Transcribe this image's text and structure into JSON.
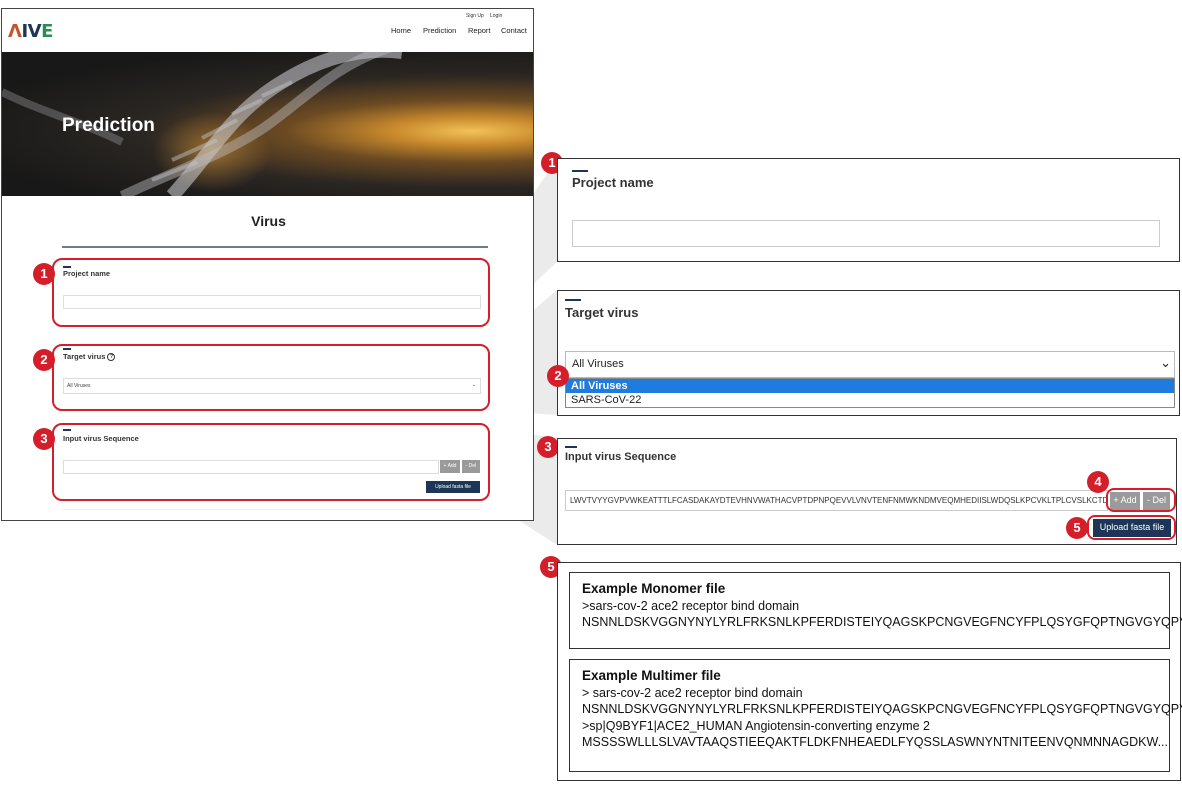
{
  "site": {
    "logo": {
      "a": "Λ",
      "b": "IV",
      "c": "E"
    },
    "top_links": {
      "signup": "Sign Up",
      "login": "Login"
    },
    "nav": [
      "Home",
      "Prediction",
      "Report",
      "Contact"
    ],
    "hero_title": "Prediction",
    "section_title": "Virus"
  },
  "form": {
    "project_name_label": "Project name",
    "target_virus_label": "Target virus",
    "info_icon_glyph": "?",
    "target_virus_value": "All Viruses",
    "target_virus_options": [
      "All Viruses",
      "SARS-CoV-22"
    ],
    "sequence_label": "Input virus Sequence",
    "sequence_value": "LWVTVYYGVPVWKEATTTLFCASDAKAYDTEVHNVWATHACVPTDPNPQEVVLVNVTENFNMWKNDMVEQMHEDIISLWDQSLKPCVKLTPLCVSLKCTDLKNDT",
    "add_button": "+ Add",
    "del_button": "- Del",
    "add_button_small": "+ Add",
    "del_button_small": "- Del",
    "upload_button": "Upload fasta file"
  },
  "badges": [
    "1",
    "2",
    "3",
    "4",
    "5"
  ],
  "examples": {
    "monomer": {
      "title": "Example Monomer file",
      "lines": [
        ">sars-cov-2 ace2 receptor bind domain",
        "NSNNLDSKVGGNYNYLYRLFRKSNLKPFERDISTEIYQAGSKPCNGVEGFNCYFPLQSYGFQPTNGVGYQPY"
      ]
    },
    "multimer": {
      "title": "Example Multimer file",
      "lines": [
        "> sars-cov-2 ace2 receptor bind domain",
        "NSNNLDSKVGGNYNYLYRLFRKSNLKPFERDISTEIYQAGSKPCNGVEGFNCYFPLQSYGFQPTNGVGYQPY",
        ">sp|Q9BYF1|ACE2_HUMAN Angiotensin-converting enzyme 2",
        "MSSSSWLLLSLVAVTAAQSTIEEQAKTFLDKFNHEAEDLFYQSSLASWNYNTNITEENVQNMNNAGDKW..."
      ]
    }
  },
  "colors": {
    "accent_red": "#d41f2b",
    "navy": "#1d3557",
    "select_highlight": "#1e7be0"
  }
}
